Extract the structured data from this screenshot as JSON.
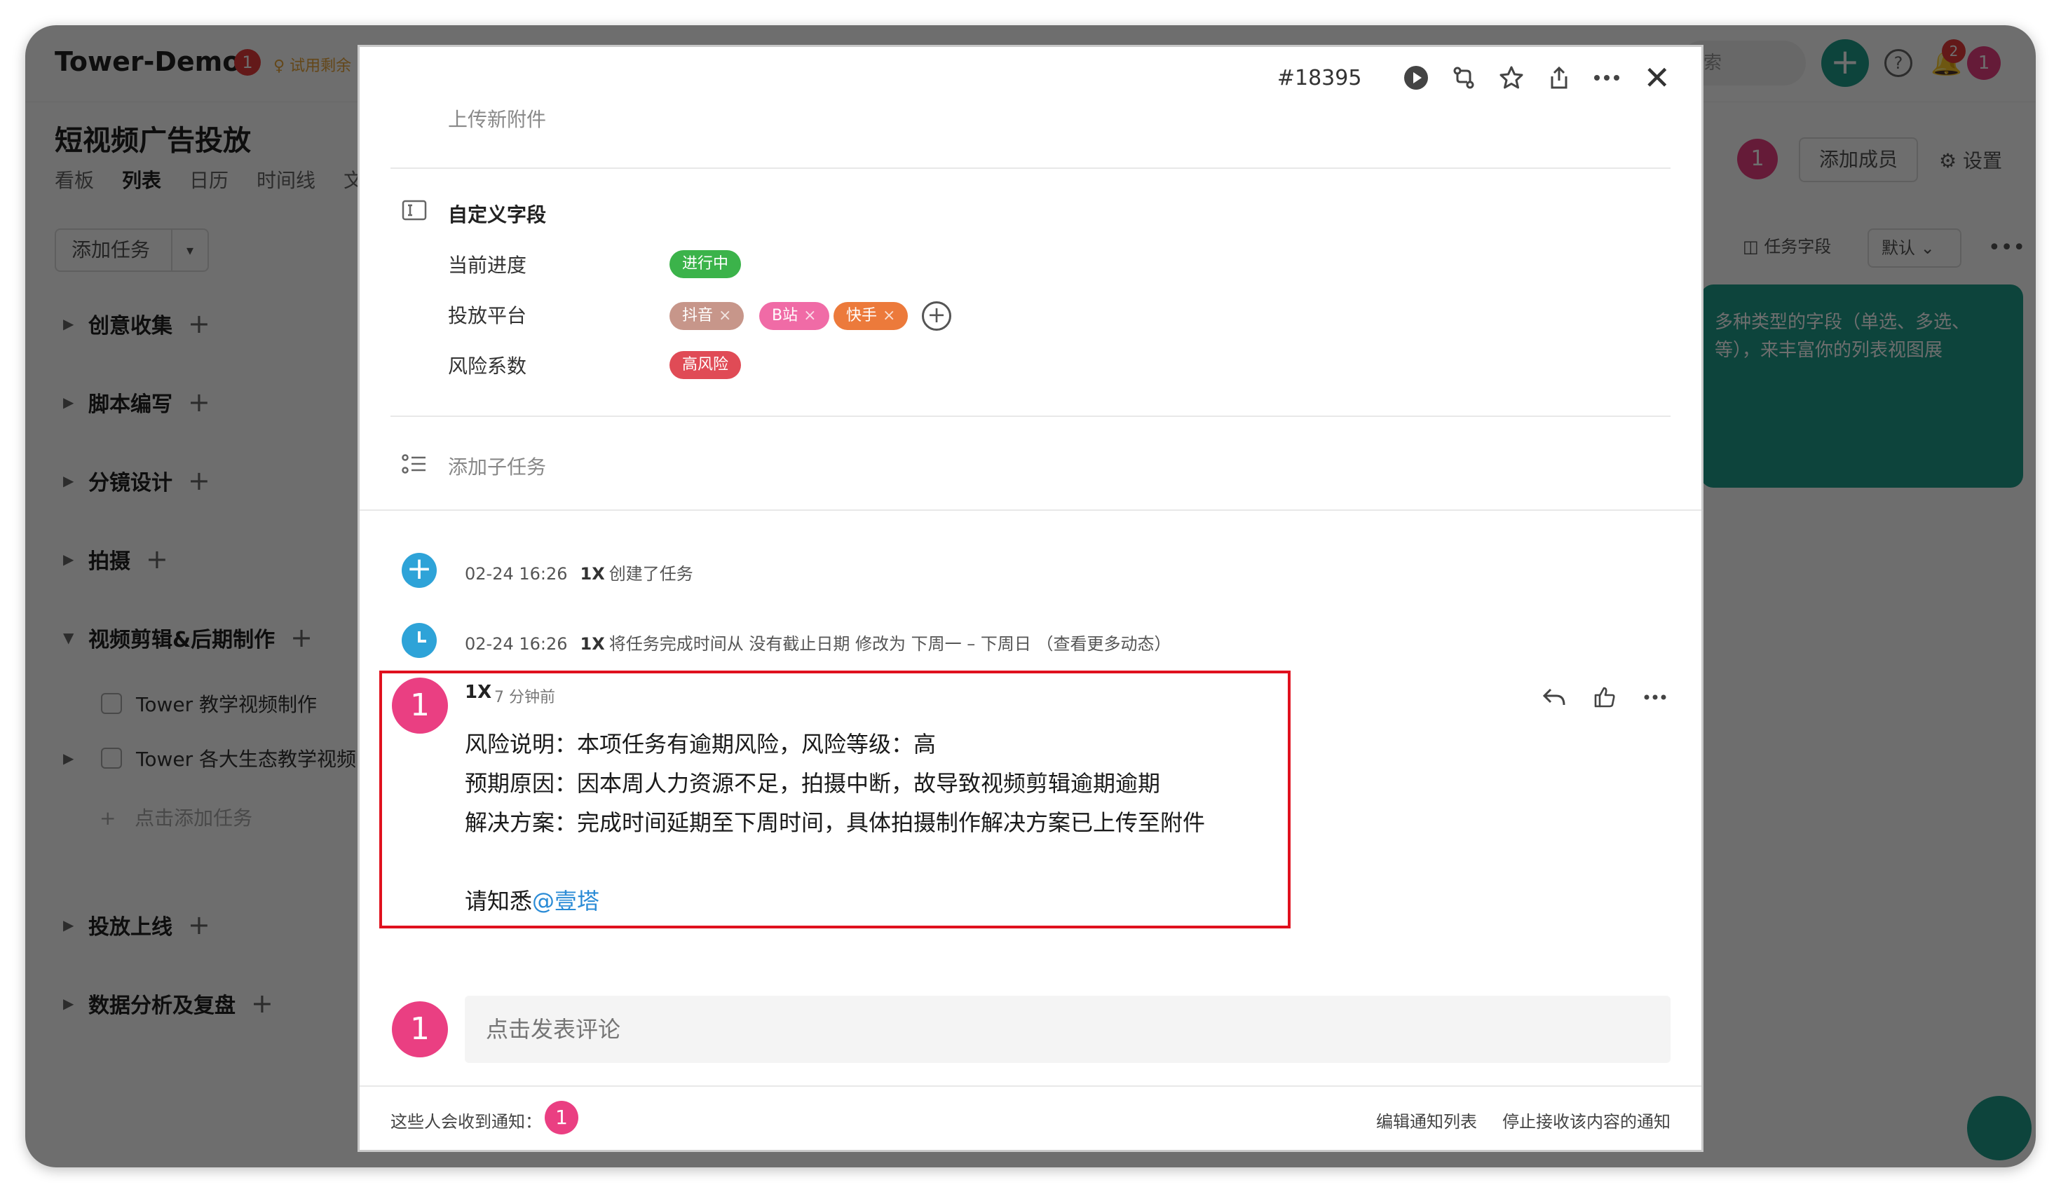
{
  "app": {
    "brand": "Tower-Demo",
    "brand_badge": "1",
    "trial_text": "试用剩余",
    "search_placeholder": "索",
    "plus": "+",
    "help": "?",
    "notifications_count": "2",
    "user_avatar": "1",
    "project_title": "短视频广告投放",
    "view_tabs": [
      "看板",
      "列表",
      "日历",
      "时间线",
      "文"
    ],
    "members_badge": "1",
    "add_member": "添加成员",
    "settings": "设置",
    "add_task": "添加任务",
    "task_fields": "任务字段",
    "default_view": "默认",
    "tip_text": "多种类型的字段（单选、多选、等），来丰富你的列表视图展",
    "groups": [
      "创意收集",
      "脚本编写",
      "分镜设计",
      "拍摄",
      "视频剪辑&后期制作",
      "投放上线",
      "数据分析及复盘"
    ],
    "tasks": [
      "Tower 教学视频制作",
      "Tower 各大生态教学视频"
    ],
    "add_inline": "点击添加任务"
  },
  "modal": {
    "task_number": "#18395",
    "upload_link": "上传新附件",
    "custom_fields": {
      "title": "自定义字段",
      "progress": {
        "label": "当前进度",
        "value": "进行中",
        "color": "#3bb34a"
      },
      "platform": {
        "label": "投放平台",
        "tags": [
          {
            "text": "抖音",
            "color": "#c7968a"
          },
          {
            "text": "B站",
            "color": "#f06ba6"
          },
          {
            "text": "快手",
            "color": "#ec7a3b"
          }
        ]
      },
      "risk": {
        "label": "风险系数",
        "value": "高风险",
        "color": "#e04b56"
      }
    },
    "subtask_link": "添加子任务",
    "activity": [
      {
        "time": "02-24 16:26",
        "user": "1X",
        "text": "创建了任务"
      },
      {
        "time": "02-24 16:26",
        "user": "1X",
        "text": "将任务完成时间从 没有截止日期 修改为 下周一 – 下周日 （查看更多动态）"
      }
    ],
    "comment": {
      "avatar": "1",
      "author": "1X",
      "time": "7 分钟前",
      "lines": [
        "风险说明：本项任务有逾期风险，风险等级：高",
        "预期原因：因本周人力资源不足，拍摄中断，故导致视频剪辑逾期逾期",
        "解决方案：完成时间延期至下周时间，具体拍摄制作解决方案已上传至附件"
      ],
      "closing_prefix": "请知悉",
      "mention": "@壹塔"
    },
    "comment_input_placeholder": "点击发表评论",
    "notify_label": "这些人会收到通知：",
    "notify_badge": "1",
    "edit_notify": "编辑通知列表",
    "stop_notify": "停止接收该内容的通知"
  }
}
